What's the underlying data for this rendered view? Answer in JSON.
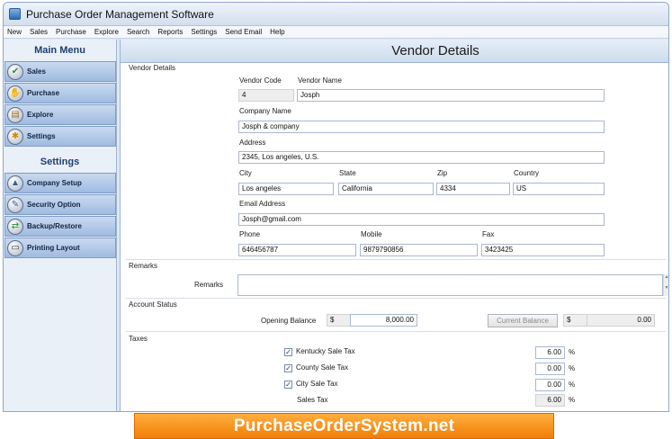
{
  "window": {
    "title": "Purchase Order Management Software"
  },
  "menu": [
    "New",
    "Sales",
    "Purchase",
    "Explore",
    "Search",
    "Reports",
    "Settings",
    "Send Email",
    "Help"
  ],
  "sidebar": {
    "main_header": "Main Menu",
    "main_items": [
      {
        "label": "Sales",
        "icon": "sales-icon",
        "glyph": "✔"
      },
      {
        "label": "Purchase",
        "icon": "purchase-icon",
        "glyph": "✋"
      },
      {
        "label": "Explore",
        "icon": "explore-icon",
        "glyph": "▤"
      },
      {
        "label": "Settings",
        "icon": "settings-icon",
        "glyph": "✱"
      }
    ],
    "settings_header": "Settings",
    "settings_items": [
      {
        "label": "Company Setup",
        "icon": "company-setup-icon",
        "glyph": "▲"
      },
      {
        "label": "Security Option",
        "icon": "security-icon",
        "glyph": "✎"
      },
      {
        "label": "Backup/Restore",
        "icon": "backup-icon",
        "glyph": "⇄"
      },
      {
        "label": "Printing Layout",
        "icon": "printer-icon",
        "glyph": "▭"
      }
    ]
  },
  "page": {
    "title": "Vendor Details"
  },
  "vendor": {
    "section": "Vendor Details",
    "code_label": "Vendor Code",
    "code": "4",
    "name_label": "Vendor Name",
    "name": "Josph",
    "company_label": "Company Name",
    "company": "Josph & company",
    "address_label": "Address",
    "address": "2345, Los angeles, U.S.",
    "city_label": "City",
    "city": "Los angeles",
    "state_label": "State",
    "state": "California",
    "zip_label": "Zip",
    "zip": "4334",
    "country_label": "Country",
    "country": "US",
    "email_label": "Email Address",
    "email": "Josph@gmail.com",
    "phone_label": "Phone",
    "phone": "646456787",
    "mobile_label": "Mobile",
    "mobile": "9879790856",
    "fax_label": "Fax",
    "fax": "3423425"
  },
  "remarks": {
    "section": "Remarks",
    "label": "Remarks",
    "value": ""
  },
  "account": {
    "section": "Account Status",
    "opening_label": "Opening Balance",
    "currency": "$",
    "opening_value": "8,000.00",
    "current_button": "Current Balance",
    "current_value": "0.00"
  },
  "taxes": {
    "section": "Taxes",
    "items": [
      {
        "label": "Kentucky Sale Tax",
        "value": "6.00",
        "checked": true
      },
      {
        "label": "County Sale Tax",
        "value": "0.00",
        "checked": true
      },
      {
        "label": "City Sale Tax",
        "value": "0.00",
        "checked": true
      }
    ],
    "total_label": "Sales Tax",
    "total_value": "6.00",
    "unit": "%",
    "check_mark": "✓"
  },
  "banner": {
    "text": "PurchaseOrderSystem.net"
  }
}
